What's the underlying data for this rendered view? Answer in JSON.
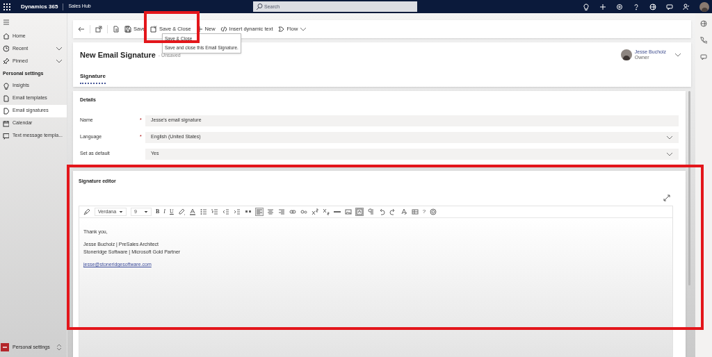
{
  "top_bar": {
    "app_name": "Dynamics 365",
    "area": "Sales Hub",
    "search": {
      "placeholder": "Search"
    }
  },
  "sidebar": {
    "nav": [
      {
        "label": "Home",
        "chevron": false
      },
      {
        "label": "Recent",
        "chevron": true
      },
      {
        "label": "Pinned",
        "chevron": true
      }
    ],
    "section_title": "Personal settings",
    "items": [
      {
        "label": "Insights",
        "selected": false
      },
      {
        "label": "Email templates",
        "selected": false
      },
      {
        "label": "Email signatures",
        "selected": true
      },
      {
        "label": "Calendar",
        "selected": false
      },
      {
        "label": "Text message templa...",
        "selected": false
      }
    ],
    "area_switcher": {
      "label": "Personal settings"
    }
  },
  "command_bar": {
    "commands": [
      {
        "label": "Save"
      },
      {
        "label": "Save & Close"
      },
      {
        "label": "New"
      },
      {
        "label": "Insert dynamic text"
      },
      {
        "label": "Flow"
      }
    ]
  },
  "tooltip": {
    "title": "Save & Close",
    "description": "Save and close this Email Signature."
  },
  "form_header": {
    "title": "New Email Signature",
    "status": "- Unsaved",
    "owner": {
      "name": "Jesse Bucholz",
      "role": "Owner"
    },
    "tabs": [
      {
        "label": "Signature",
        "selected": true
      }
    ]
  },
  "details": {
    "heading": "Details",
    "fields": [
      {
        "label": "Name",
        "required_marker": "*",
        "kind": "text",
        "value": "Jesse's email signature"
      },
      {
        "label": "Language",
        "required_marker": "*",
        "kind": "select",
        "value": "English (United States)"
      },
      {
        "label": "Set as default",
        "kind": "select",
        "value": "Yes"
      }
    ]
  },
  "signature_editor": {
    "heading": "Signature editor",
    "font": "Verdana",
    "size": "9",
    "text_buttons": [
      "B",
      "I",
      "U"
    ],
    "help_button": "?",
    "paragraphs": [
      {
        "kind": "text",
        "lines": [
          "Thank you,"
        ]
      },
      {
        "kind": "text",
        "lines": [
          "Jesse Bucholz | PreSales Architect",
          "Stoneridge Software | Microsoft Gold Partner"
        ]
      },
      {
        "kind": "link",
        "lines": [
          "jesse@stoneridgesoftware.com"
        ]
      }
    ]
  }
}
